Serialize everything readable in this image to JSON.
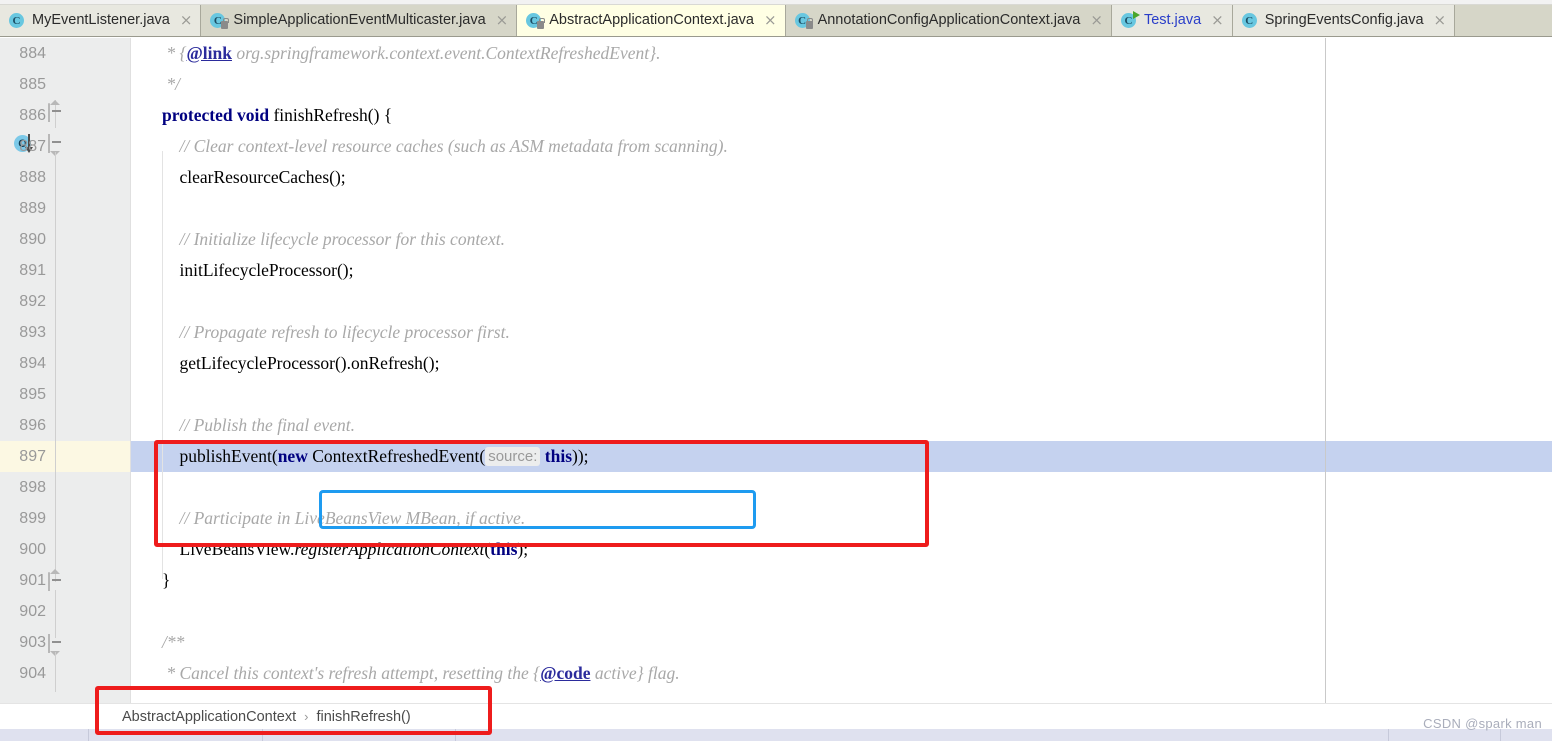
{
  "tabs": [
    {
      "label": "MyEventListener.java",
      "icon": "java-class-icon",
      "state": "inactive",
      "locked": false,
      "runnable": false,
      "blue": false
    },
    {
      "label": "SimpleApplicationEventMulticaster.java",
      "icon": "java-class-icon",
      "state": "inactive",
      "locked": true,
      "runnable": false,
      "blue": false
    },
    {
      "label": "AbstractApplicationContext.java",
      "icon": "java-class-icon",
      "state": "active",
      "locked": true,
      "runnable": false,
      "blue": false
    },
    {
      "label": "AnnotationConfigApplicationContext.java",
      "icon": "java-class-icon",
      "state": "inactive",
      "locked": true,
      "runnable": false,
      "blue": false
    },
    {
      "label": "Test.java",
      "icon": "java-class-icon",
      "state": "inactive",
      "locked": false,
      "runnable": true,
      "blue": true
    },
    {
      "label": "SpringEventsConfig.java",
      "icon": "java-class-icon",
      "state": "inactive",
      "locked": false,
      "runnable": false,
      "blue": false
    }
  ],
  "tab_close_glyph": "×",
  "editor": {
    "first_line_number": 884,
    "current_line_number": 897,
    "lines": [
      {
        "num": "884",
        "text": " * {@link org.springframework.context.event.ContextRefreshedEvent}."
      },
      {
        "num": "885",
        "text": " */"
      },
      {
        "num": "886",
        "text": "protected void finishRefresh() {"
      },
      {
        "num": "887",
        "text": "    // Clear context-level resource caches (such as ASM metadata from scanning)."
      },
      {
        "num": "888",
        "text": "    clearResourceCaches();"
      },
      {
        "num": "889",
        "text": ""
      },
      {
        "num": "890",
        "text": "    // Initialize lifecycle processor for this context."
      },
      {
        "num": "891",
        "text": "    initLifecycleProcessor();"
      },
      {
        "num": "892",
        "text": ""
      },
      {
        "num": "893",
        "text": "    // Propagate refresh to lifecycle processor first."
      },
      {
        "num": "894",
        "text": "    getLifecycleProcessor().onRefresh();"
      },
      {
        "num": "895",
        "text": ""
      },
      {
        "num": "896",
        "text": "    // Publish the final event."
      },
      {
        "num": "897",
        "text": "    publishEvent(new ContextRefreshedEvent( source: this));"
      },
      {
        "num": "898",
        "text": ""
      },
      {
        "num": "899",
        "text": "    // Participate in LiveBeansView MBean, if active."
      },
      {
        "num": "900",
        "text": "    LiveBeansView.registerApplicationContext(this);"
      },
      {
        "num": "901",
        "text": "}"
      },
      {
        "num": "902",
        "text": ""
      },
      {
        "num": "903",
        "text": "/**"
      },
      {
        "num": "904",
        "text": " * Cancel this context's refresh attempt, resetting the {@code active} flag."
      }
    ],
    "inlay_hint": "source:",
    "gutter_icons": {
      "override_marker": "O",
      "override_line": "886"
    }
  },
  "breadcrumb": {
    "items": [
      "AbstractApplicationContext",
      "finishRefresh()"
    ],
    "separator": "›"
  },
  "annotations": {
    "red_box_code_label": "red-highlight-publish-event",
    "blue_box_label": "blue-highlight-new-context-refreshed-event",
    "red_box_breadcrumb_label": "red-highlight-breadcrumb"
  },
  "watermark": "CSDN @spark man",
  "colors": {
    "keyword": "#000080",
    "comment": "#a8a8a8",
    "current_line": "#c5d2ef",
    "current_line_gutter": "#fcf8e3",
    "annotation_red": "#ee1c1c",
    "annotation_blue": "#1e9bf0",
    "tab_active_bg": "#ffffe4",
    "tab_bar_bg": "#d6d6c8"
  }
}
